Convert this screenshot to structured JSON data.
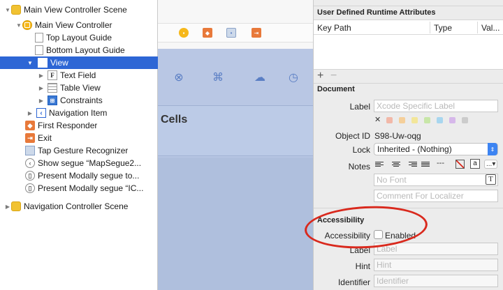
{
  "outline": {
    "rows": [
      {
        "label": "Main View Controller Scene",
        "icon": "scene-icon",
        "tri": "▼"
      },
      {
        "label": "Main View Controller",
        "icon": "view-controller-icon",
        "tri": "▼"
      },
      {
        "label": "Top Layout Guide",
        "icon": "layout-guide-icon",
        "tri": ""
      },
      {
        "label": "Bottom Layout Guide",
        "icon": "layout-guide-icon",
        "tri": ""
      },
      {
        "label": "View",
        "icon": "view-icon",
        "tri": "▼",
        "selected": true
      },
      {
        "label": "Text Field",
        "icon": "text-field-icon",
        "tri": "▶"
      },
      {
        "label": "Table View",
        "icon": "table-view-icon",
        "tri": "▶"
      },
      {
        "label": "Constraints",
        "icon": "constraints-icon",
        "tri": "▶"
      },
      {
        "label": "Navigation Item",
        "icon": "navigation-item-icon",
        "tri": "▶"
      },
      {
        "label": "First Responder",
        "icon": "first-responder-icon",
        "tri": ""
      },
      {
        "label": "Exit",
        "icon": "exit-icon",
        "tri": ""
      },
      {
        "label": "Tap Gesture Recognizer",
        "icon": "tap-gesture-icon",
        "tri": ""
      },
      {
        "label": "Show segue “MapSegue2...",
        "icon": "segue-icon",
        "tri": ""
      },
      {
        "label": "Present Modally segue to...",
        "icon": "segue-icon",
        "tri": ""
      },
      {
        "label": "Present Modally segue “IC...",
        "icon": "segue-icon",
        "tri": ""
      },
      {
        "label": "Navigation Controller Scene",
        "icon": "scene-icon",
        "tri": "▶"
      }
    ]
  },
  "canvas": {
    "cells_label": "Cells"
  },
  "inspector": {
    "udra": {
      "title": "User Defined Runtime Attributes",
      "col_key_path": "Key Path",
      "col_type": "Type",
      "col_value": "Val...",
      "add": "+",
      "remove": "−"
    },
    "document": {
      "title": "Document",
      "label_label": "Label",
      "label_placeholder": "Xcode Specific Label",
      "clear_glyph": "✕",
      "swatch_colors": [
        "#f2b8a8",
        "#f5cf9a",
        "#f3e69a",
        "#c8e6a8",
        "#a8d6ef",
        "#d6b8ea",
        "#cccccc"
      ],
      "object_id_label": "Object ID",
      "object_id_value": "S98-Uw-oqg",
      "lock_label": "Lock",
      "lock_value": "Inherited - (Nothing)",
      "notes_label": "Notes",
      "font_placeholder": "No Font",
      "comment_placeholder": "Comment For Localizer",
      "notes_dash": "---",
      "notes_a": "a",
      "notes_more": "...▾"
    },
    "accessibility": {
      "title": "Accessibility",
      "accessibility_label": "Accessibility",
      "enabled_label": "Enabled",
      "label_label": "Label",
      "label_placeholder": "Label",
      "hint_label": "Hint",
      "hint_placeholder": "Hint",
      "identifier_label": "Identifier",
      "identifier_placeholder": "Identifier"
    }
  },
  "colors": {
    "selection": "#2d66d5",
    "annotation": "#d9291d",
    "accent": "#3d84f2"
  }
}
